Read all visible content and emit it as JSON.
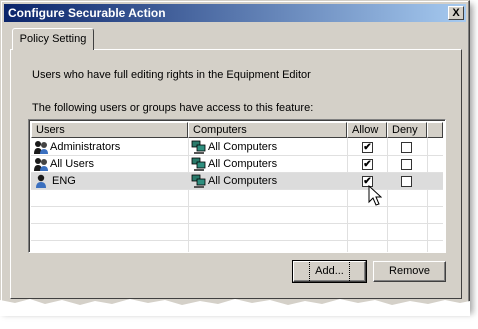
{
  "window": {
    "title": "Configure Securable Action",
    "close_label": "X"
  },
  "tab": {
    "label": "Policy Setting"
  },
  "description": "Users who have full editing rights in the Equipment Editor",
  "access_label": "The following users or groups have access to this feature:",
  "table": {
    "columns": {
      "users": "Users",
      "computers": "Computers",
      "allow": "Allow",
      "deny": "Deny"
    },
    "rows": [
      {
        "user": "Administrators",
        "computer": "All Computers",
        "allow": "✔",
        "deny": "",
        "user_icon": "group-users-icon",
        "computer_icon": "computers-icon"
      },
      {
        "user": "All Users",
        "computer": "All Computers",
        "allow": "✔",
        "deny": "",
        "user_icon": "group-users-icon",
        "computer_icon": "computers-icon"
      },
      {
        "user": "ENG",
        "computer": "All Computers",
        "allow": "✔",
        "deny": "",
        "user_icon": "user-icon",
        "computer_icon": "computers-icon"
      }
    ]
  },
  "buttons": {
    "add": "Add...",
    "remove": "Remove"
  }
}
